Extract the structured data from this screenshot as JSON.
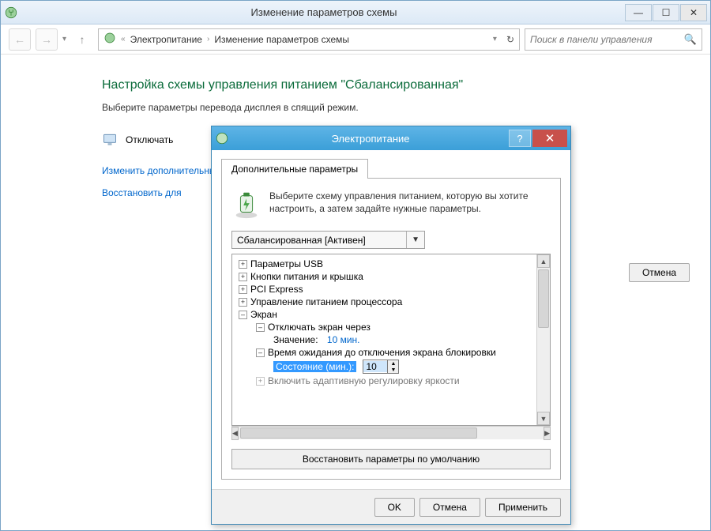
{
  "window": {
    "title": "Изменение параметров схемы"
  },
  "breadcrumb": {
    "root": "Электропитание",
    "leaf": "Изменение параметров схемы"
  },
  "search": {
    "placeholder": "Поиск в панели управления"
  },
  "page": {
    "heading": "Настройка схемы управления питанием \"Сбалансированная\"",
    "sub": "Выберите параметры перевода дисплея в спящий режим.",
    "turn_off_label": "Отключать",
    "link_advanced": "Изменить дополнительные",
    "link_restore": "Восстановить для",
    "cancel": "Отмена"
  },
  "dialog": {
    "title": "Электропитание",
    "tab": "Дополнительные параметры",
    "intro": "Выберите схему управления питанием, которую вы хотите настроить, а затем задайте нужные параметры.",
    "plan_selected": "Сбалансированная [Активен]",
    "tree": {
      "usb": "Параметры USB",
      "buttons": "Кнопки питания и крышка",
      "pci": "PCI Express",
      "cpu": "Управление питанием процессора",
      "display": "Экран",
      "turn_off": "Отключать экран через",
      "value_label": "Значение:",
      "value_text": "10 мин.",
      "lock_wait": "Время ожидания до отключения экрана блокировки",
      "state_label": "Состояние (мин.):",
      "state_value": "10",
      "adaptive": "Включить адаптивную регулировку яркости"
    },
    "restore_defaults": "Восстановить параметры по умолчанию",
    "ok": "OK",
    "cancel": "Отмена",
    "apply": "Применить"
  }
}
